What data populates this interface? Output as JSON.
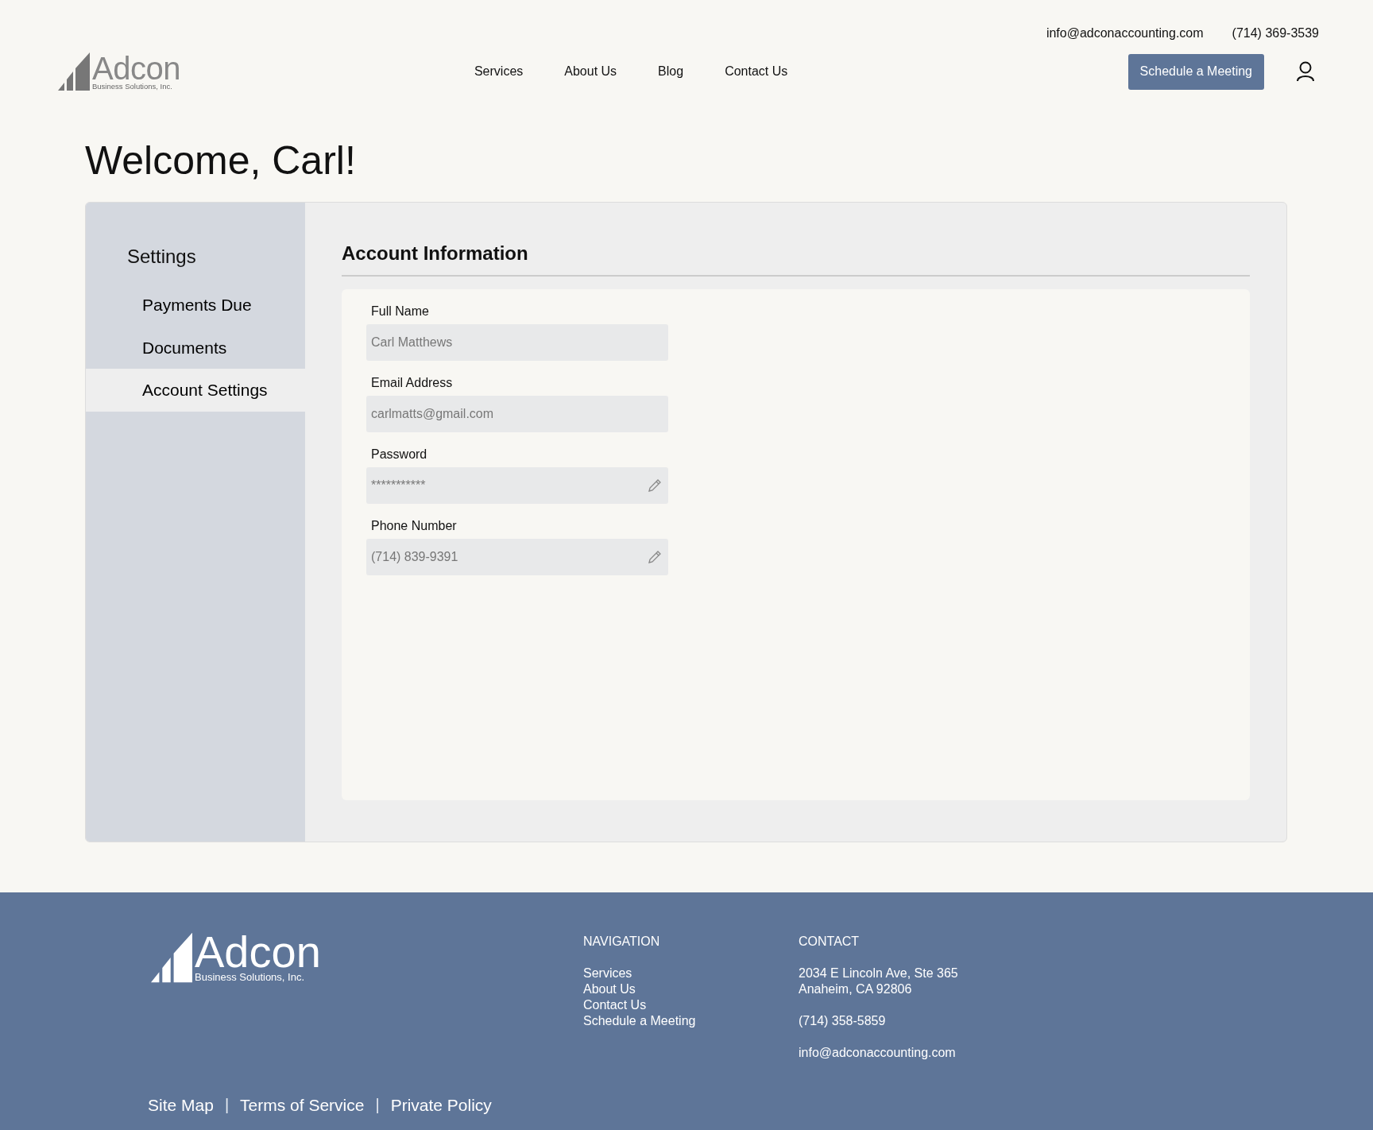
{
  "header": {
    "logo": {
      "name": "Adcon",
      "tagline": "Business Solutions, Inc."
    },
    "email": "info@adconaccounting.com",
    "phone": "(714) 369-3539",
    "nav": [
      "Services",
      "About Us",
      "Blog",
      "Contact Us"
    ],
    "cta": "Schedule a Meeting"
  },
  "welcome": "Welcome, Carl!",
  "sidebar": {
    "title": "Settings",
    "items": [
      {
        "label": "Payments Due",
        "selected": false
      },
      {
        "label": "Documents",
        "selected": false
      },
      {
        "label": "Account Settings",
        "selected": true
      }
    ]
  },
  "account": {
    "title": "Account Information",
    "fields": [
      {
        "label": "Full Name",
        "value": "Carl Matthews",
        "editable": false
      },
      {
        "label": "Email Address",
        "value": "carlmatts@gmail.com",
        "editable": false
      },
      {
        "label": "Password",
        "value": "***********",
        "editable": true
      },
      {
        "label": "Phone Number",
        "value": "(714) 839-9391",
        "editable": true
      }
    ]
  },
  "footer": {
    "logo": {
      "name": "Adcon",
      "tagline": "Business Solutions, Inc."
    },
    "navigation": {
      "title": "NAVIGATION",
      "links": [
        "Services",
        "About Us",
        "Contact Us",
        "Schedule a Meeting"
      ]
    },
    "contact": {
      "title": "CONTACT",
      "address": [
        "2034 E Lincoln Ave, Ste 365",
        "Anaheim, CA 92806"
      ],
      "phone": "(714) 358-5859",
      "email": "info@adconaccounting.com"
    },
    "bottom_bar": [
      {
        "kind": "link",
        "text": "Site Map"
      },
      {
        "kind": "separator",
        "text": "|"
      },
      {
        "kind": "link",
        "text": "Terms of Service"
      },
      {
        "kind": "separator",
        "text": "|"
      },
      {
        "kind": "link",
        "text": "Private Policy"
      }
    ]
  }
}
